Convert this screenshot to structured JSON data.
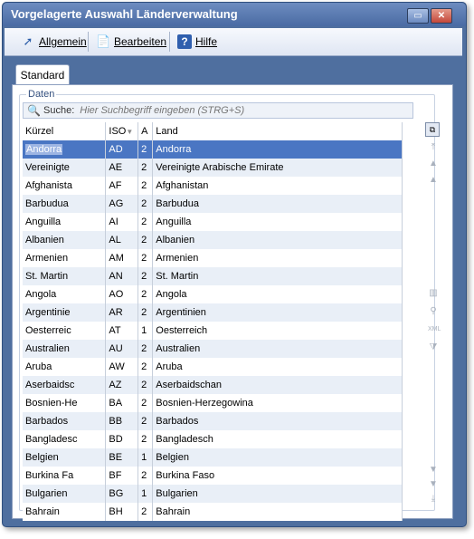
{
  "window": {
    "title": "Vorgelagerte Auswahl Länderverwaltung"
  },
  "toolbar": {
    "allgemein_label": "Allgemein",
    "bearbeiten_label": "Bearbeiten",
    "hilfe_label": "Hilfe"
  },
  "tabs": [
    {
      "label": "Standard"
    }
  ],
  "group": {
    "label": "Daten"
  },
  "search": {
    "label": "Suche:",
    "placeholder": "Hier Suchbegriff eingeben (STRG+S)"
  },
  "table": {
    "columns": [
      "Kürzel",
      "ISO",
      "A",
      "Land"
    ],
    "selected_index": 0,
    "rows": [
      [
        "Andorra",
        "AD",
        "2",
        "Andorra"
      ],
      [
        "Vereinigte",
        "AE",
        "2",
        "Vereinigte Arabische Emirate"
      ],
      [
        "Afghanista",
        "AF",
        "2",
        "Afghanistan"
      ],
      [
        "Barbudua",
        "AG",
        "2",
        "Barbudua"
      ],
      [
        "Anguilla",
        "AI",
        "2",
        "Anguilla"
      ],
      [
        "Albanien",
        "AL",
        "2",
        "Albanien"
      ],
      [
        "Armenien",
        "AM",
        "2",
        "Armenien"
      ],
      [
        "St. Martin",
        "AN",
        "2",
        "St. Martin"
      ],
      [
        "Angola",
        "AO",
        "2",
        "Angola"
      ],
      [
        "Argentinie",
        "AR",
        "2",
        "Argentinien"
      ],
      [
        "Oesterreic",
        "AT",
        "1",
        "Oesterreich"
      ],
      [
        "Australien",
        "AU",
        "2",
        "Australien"
      ],
      [
        "Aruba",
        "AW",
        "2",
        "Aruba"
      ],
      [
        "Aserbaidsc",
        "AZ",
        "2",
        "Aserbaidschan"
      ],
      [
        "Bosnien-He",
        "BA",
        "2",
        "Bosnien-Herzegowina"
      ],
      [
        "Barbados",
        "BB",
        "2",
        "Barbados"
      ],
      [
        "Bangladesc",
        "BD",
        "2",
        "Bangladesch"
      ],
      [
        "Belgien",
        "BE",
        "1",
        "Belgien"
      ],
      [
        "Burkina Fa",
        "BF",
        "2",
        "Burkina Faso"
      ],
      [
        "Bulgarien",
        "BG",
        "1",
        "Bulgarien"
      ],
      [
        "Bahrain",
        "BH",
        "2",
        "Bahrain"
      ]
    ]
  }
}
